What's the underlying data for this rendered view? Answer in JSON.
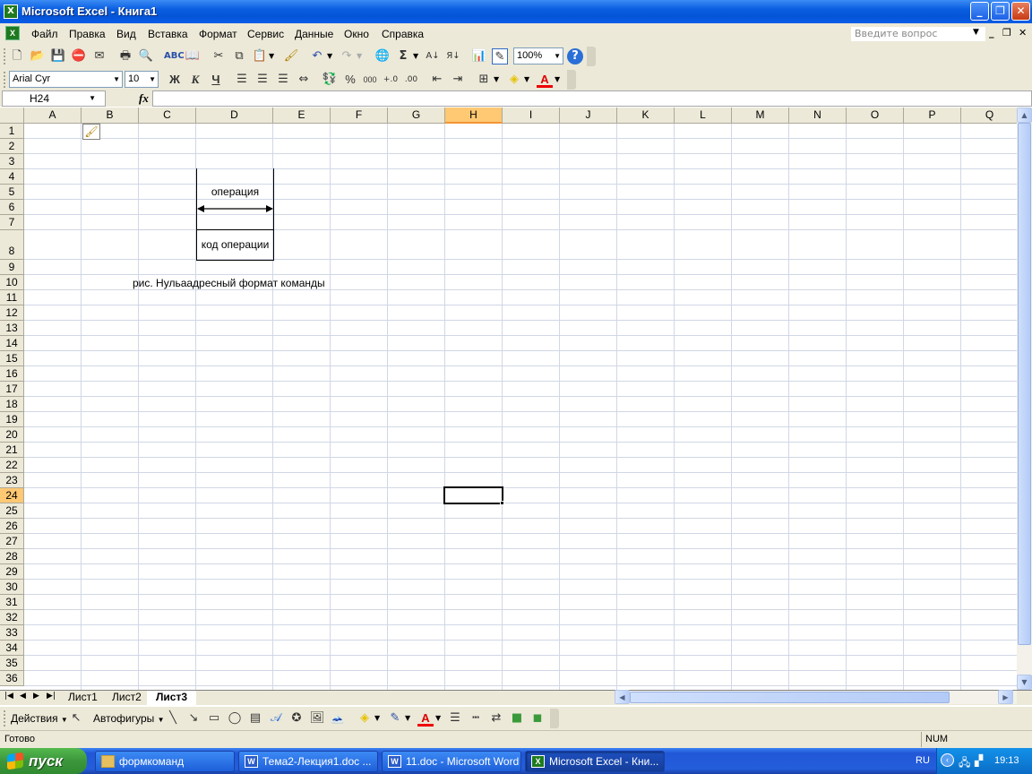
{
  "window": {
    "title": "Microsoft Excel - Книга1",
    "controls": {
      "minimize": "_",
      "maximize": "❐",
      "close": "✕"
    }
  },
  "menubar": {
    "items": [
      "Файл",
      "Правка",
      "Вид",
      "Вставка",
      "Формат",
      "Сервис",
      "Данные",
      "Окно",
      "Справка"
    ],
    "ask_placeholder": "Введите вопрос"
  },
  "standard_toolbar": {
    "zoom": "100%",
    "icons": [
      "new-icon",
      "open-icon",
      "save-icon",
      "permission-icon",
      "email-icon",
      "print-icon",
      "print-preview-icon",
      "spelling-icon",
      "research-icon",
      "cut-icon",
      "copy-icon",
      "paste-icon",
      "format-painter-icon",
      "undo-icon",
      "redo-icon",
      "hyperlink-icon",
      "autosum-icon",
      "sort-ascending-icon",
      "sort-descending-icon",
      "chart-wizard-icon",
      "drawing-icon",
      "help-icon"
    ]
  },
  "formatting_toolbar": {
    "font": "Arial Cyr",
    "size": "10",
    "bold": "Ж",
    "italic": "К",
    "underline": "Ч",
    "percent": "%",
    "thousands": "000"
  },
  "formula_bar": {
    "name_box": "H24",
    "fx": "fx",
    "value": ""
  },
  "sheet": {
    "columns": [
      "A",
      "B",
      "C",
      "D",
      "E",
      "F",
      "G",
      "H",
      "I",
      "J",
      "K",
      "L",
      "M",
      "N",
      "O",
      "P",
      "Q"
    ],
    "rows": [
      "1",
      "2",
      "3",
      "4",
      "5",
      "6",
      "7",
      "8",
      "9",
      "10",
      "11",
      "12",
      "13",
      "14",
      "15",
      "16",
      "17",
      "18",
      "19",
      "20",
      "21",
      "22",
      "23",
      "24",
      "25",
      "26",
      "27",
      "28",
      "29",
      "30",
      "31",
      "32",
      "33",
      "34",
      "35",
      "36"
    ],
    "selected_cell": "H24",
    "selected_column": "H",
    "selected_row": "24",
    "diagram": {
      "label_top": "операция",
      "label_bottom": "код операции"
    },
    "caption": "рис. Нульаадресный формат команды"
  },
  "tabs": {
    "sheets": [
      "Лист1",
      "Лист2",
      "Лист3"
    ],
    "active": "Лист3"
  },
  "drawing_toolbar": {
    "actions": "Действия",
    "autoshapes": "Автофигуры"
  },
  "status": {
    "ready": "Готово",
    "num": "NUM"
  },
  "taskbar": {
    "start": "пуск",
    "tasks": [
      "формкоманд",
      "Тема2-Лекция1.doc ...",
      "11.doc - Microsoft Word",
      "Microsoft Excel - Кни..."
    ],
    "lang": "RU",
    "clock": "19:13"
  }
}
